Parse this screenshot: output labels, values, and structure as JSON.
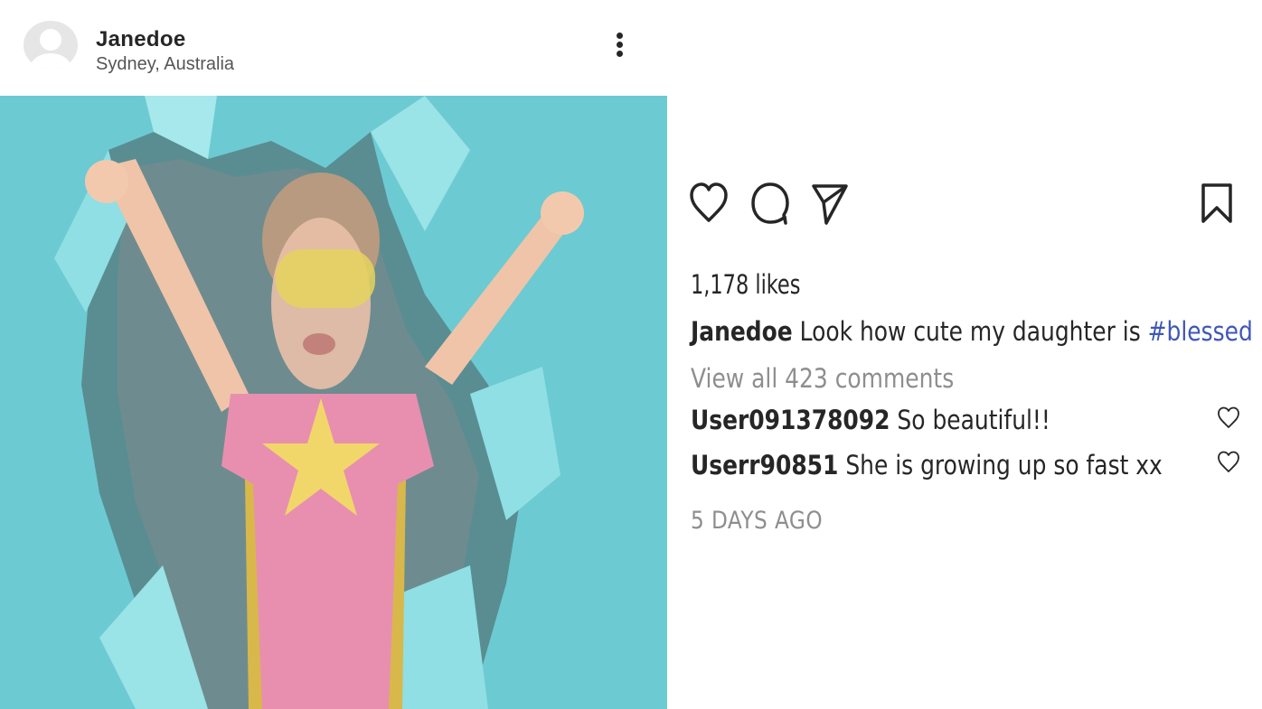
{
  "post": {
    "username": "Janedoe",
    "location": "Sydney, Australia"
  },
  "stats": {
    "likes": "1,178 likes"
  },
  "caption": {
    "username": "Janedoe",
    "text": "Look how cute my daughter is",
    "hashtag": "#blessed"
  },
  "comments_link": "View all 423 comments",
  "comments": [
    {
      "username": "User091378092",
      "text": "So beautiful!!"
    },
    {
      "username": "Userr90851",
      "text": "She is growing up so fast xx"
    }
  ],
  "timestamp": "5 DAYS AGO",
  "icons": {
    "more": "more-vertical-icon",
    "like": "heart-icon",
    "comment": "comment-icon",
    "share": "send-icon",
    "save": "bookmark-icon"
  },
  "colors": {
    "photo_background": "#6cc9d1",
    "hashtag": "#3f57b8",
    "muted_text": "#8e8e8e"
  }
}
